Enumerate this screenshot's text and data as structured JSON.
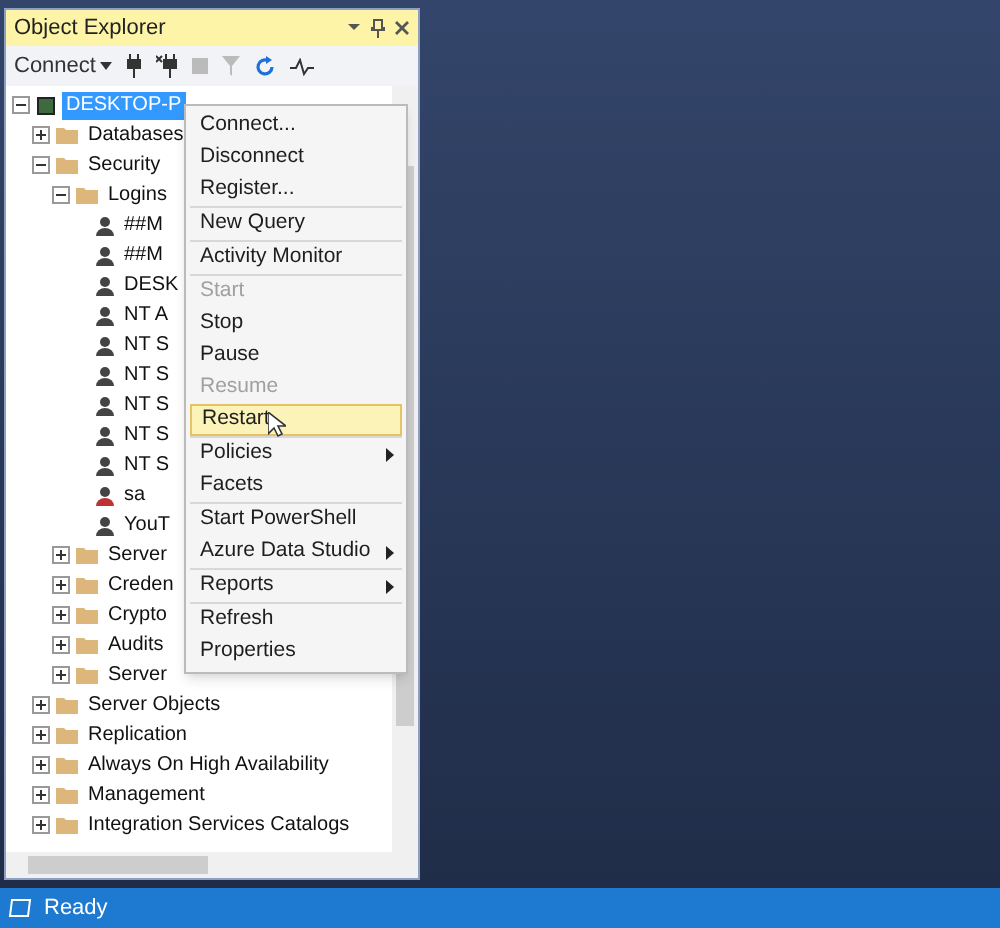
{
  "panel": {
    "title": "Object Explorer",
    "toolbar": {
      "connect_label": "Connect"
    }
  },
  "tree": [
    {
      "kind": "server",
      "label": "DESKTOP-P",
      "selected": true,
      "expanded": true,
      "children": [
        {
          "kind": "folder",
          "label": "Databases",
          "expanded": false,
          "selected": false
        },
        {
          "kind": "folder",
          "label": "Security",
          "expanded": true,
          "selected": false,
          "children": [
            {
              "kind": "folder",
              "label": "Logins",
              "expanded": true,
              "selected": false,
              "children": [
                {
                  "kind": "login",
                  "label": "##M",
                  "selected": false
                },
                {
                  "kind": "login",
                  "label": "##M",
                  "selected": false
                },
                {
                  "kind": "login",
                  "label": "DESK",
                  "selected": false
                },
                {
                  "kind": "login",
                  "label": "NT A",
                  "selected": false
                },
                {
                  "kind": "login",
                  "label": "NT S",
                  "selected": false
                },
                {
                  "kind": "login",
                  "label": "NT S",
                  "selected": false
                },
                {
                  "kind": "login",
                  "label": "NT S",
                  "selected": false
                },
                {
                  "kind": "login",
                  "label": "NT S",
                  "selected": false
                },
                {
                  "kind": "login",
                  "label": "NT S",
                  "selected": false
                },
                {
                  "kind": "login_disabled",
                  "label": "sa",
                  "selected": false
                },
                {
                  "kind": "login",
                  "label": "YouT",
                  "selected": false
                }
              ]
            },
            {
              "kind": "folder",
              "label": "Server",
              "expanded": false,
              "selected": false
            },
            {
              "kind": "folder",
              "label": "Creden",
              "expanded": false,
              "selected": false
            },
            {
              "kind": "folder",
              "label": "Crypto",
              "expanded": false,
              "selected": false
            },
            {
              "kind": "folder",
              "label": "Audits",
              "expanded": false,
              "selected": false
            },
            {
              "kind": "folder",
              "label": "Server",
              "expanded": false,
              "selected": false
            }
          ]
        },
        {
          "kind": "folder",
          "label": "Server Objects",
          "expanded": false,
          "selected": false
        },
        {
          "kind": "folder",
          "label": "Replication",
          "expanded": false,
          "selected": false
        },
        {
          "kind": "folder",
          "label": "Always On High Availability",
          "expanded": false,
          "selected": false
        },
        {
          "kind": "folder",
          "label": "Management",
          "expanded": false,
          "selected": false
        },
        {
          "kind": "folder",
          "label": "Integration Services Catalogs",
          "expanded": false,
          "selected": false
        }
      ]
    }
  ],
  "context_menu": [
    [
      {
        "label": "Connect...",
        "disabled": false,
        "submenu": false,
        "selected": false
      },
      {
        "label": "Disconnect",
        "disabled": false,
        "submenu": false,
        "selected": false
      },
      {
        "label": "Register...",
        "disabled": false,
        "submenu": false,
        "selected": false
      }
    ],
    [
      {
        "label": "New Query",
        "disabled": false,
        "submenu": false,
        "selected": false
      }
    ],
    [
      {
        "label": "Activity Monitor",
        "disabled": false,
        "submenu": false,
        "selected": false
      }
    ],
    [
      {
        "label": "Start",
        "disabled": true,
        "submenu": false,
        "selected": false
      },
      {
        "label": "Stop",
        "disabled": false,
        "submenu": false,
        "selected": false
      },
      {
        "label": "Pause",
        "disabled": false,
        "submenu": false,
        "selected": false
      },
      {
        "label": "Resume",
        "disabled": true,
        "submenu": false,
        "selected": false
      },
      {
        "label": "Restart",
        "disabled": false,
        "submenu": false,
        "selected": true
      }
    ],
    [
      {
        "label": "Policies",
        "disabled": false,
        "submenu": true,
        "selected": false
      },
      {
        "label": "Facets",
        "disabled": false,
        "submenu": false,
        "selected": false
      }
    ],
    [
      {
        "label": "Start PowerShell",
        "disabled": false,
        "submenu": false,
        "selected": false
      },
      {
        "label": "Azure Data Studio",
        "disabled": false,
        "submenu": true,
        "selected": false
      }
    ],
    [
      {
        "label": "Reports",
        "disabled": false,
        "submenu": true,
        "selected": false
      }
    ],
    [
      {
        "label": "Refresh",
        "disabled": false,
        "submenu": false,
        "selected": false
      },
      {
        "label": "Properties",
        "disabled": false,
        "submenu": false,
        "selected": false
      }
    ]
  ],
  "status_bar": {
    "text": "Ready"
  }
}
